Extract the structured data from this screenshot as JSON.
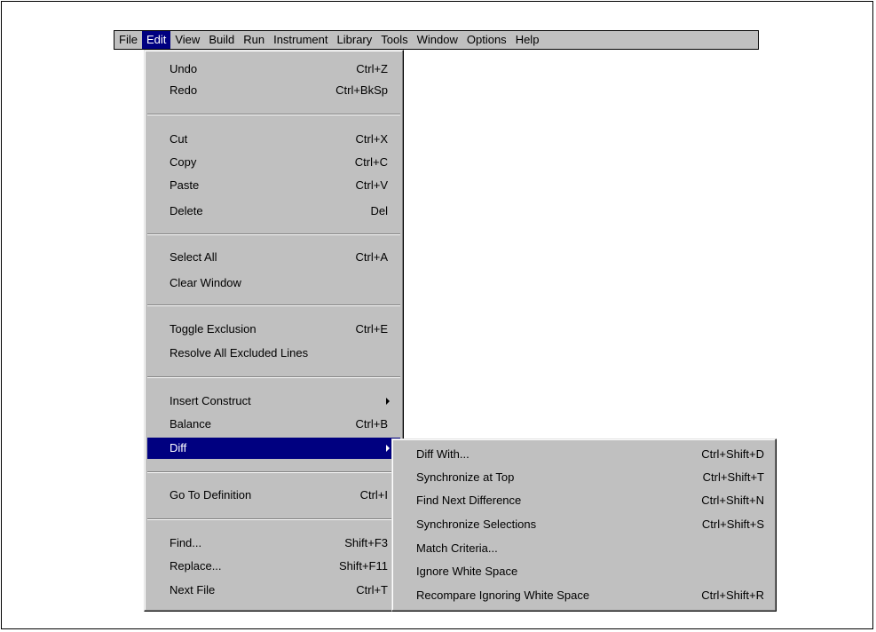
{
  "menubar": {
    "items": [
      {
        "label": "File"
      },
      {
        "label": "Edit"
      },
      {
        "label": "View"
      },
      {
        "label": "Build"
      },
      {
        "label": "Run"
      },
      {
        "label": "Instrument"
      },
      {
        "label": "Library"
      },
      {
        "label": "Tools"
      },
      {
        "label": "Window"
      },
      {
        "label": "Options"
      },
      {
        "label": "Help"
      }
    ]
  },
  "edit_menu": {
    "items": [
      {
        "label": "Undo",
        "shortcut": "Ctrl+Z"
      },
      {
        "label": "Redo",
        "shortcut": "Ctrl+BkSp"
      },
      {
        "label": "Cut",
        "shortcut": "Ctrl+X"
      },
      {
        "label": "Copy",
        "shortcut": "Ctrl+C"
      },
      {
        "label": "Paste",
        "shortcut": "Ctrl+V"
      },
      {
        "label": "Delete",
        "shortcut": "Del"
      },
      {
        "label": "Select All",
        "shortcut": "Ctrl+A"
      },
      {
        "label": "Clear Window",
        "shortcut": ""
      },
      {
        "label": "Toggle Exclusion",
        "shortcut": "Ctrl+E"
      },
      {
        "label": "Resolve All Excluded Lines",
        "shortcut": ""
      },
      {
        "label": "Insert Construct",
        "shortcut": ""
      },
      {
        "label": "Balance",
        "shortcut": "Ctrl+B"
      },
      {
        "label": "Diff",
        "shortcut": ""
      },
      {
        "label": "Go To Definition",
        "shortcut": "Ctrl+I"
      },
      {
        "label": "Find...",
        "shortcut": "Shift+F3"
      },
      {
        "label": "Replace...",
        "shortcut": "Shift+F11"
      },
      {
        "label": "Next File",
        "shortcut": "Ctrl+T"
      }
    ]
  },
  "diff_menu": {
    "items": [
      {
        "label": "Diff With...",
        "shortcut": "Ctrl+Shift+D"
      },
      {
        "label": "Synchronize at Top",
        "shortcut": "Ctrl+Shift+T"
      },
      {
        "label": "Find Next Difference",
        "shortcut": "Ctrl+Shift+N"
      },
      {
        "label": "Synchronize Selections",
        "shortcut": "Ctrl+Shift+S"
      },
      {
        "label": "Match Criteria...",
        "shortcut": ""
      },
      {
        "label": "Ignore White Space",
        "shortcut": ""
      },
      {
        "label": "Recompare Ignoring White Space",
        "shortcut": "Ctrl+Shift+R"
      }
    ]
  },
  "colors": {
    "menu_face": "#c0c0c0",
    "highlight": "#000080",
    "highlight_text": "#ffffff"
  },
  "icons": {
    "submenu_arrow": "submenu-arrow-icon"
  }
}
